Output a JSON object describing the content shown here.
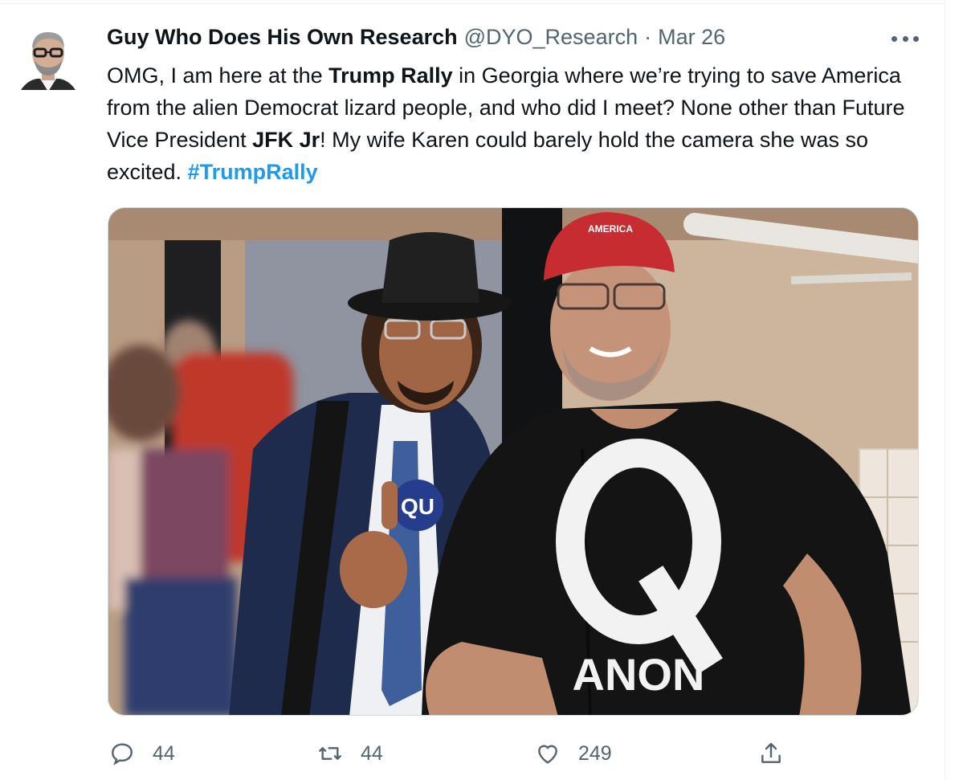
{
  "tweet": {
    "author": {
      "name": "Guy Who Does His Own Research",
      "handle": "@DYO_Research"
    },
    "separator": "·",
    "date": "Mar 26",
    "text": {
      "p1": "OMG, I am here at the ",
      "b1": "Trump Rally",
      "p2": " in Georgia where we’re trying to save America from the alien Democrat lizard people, and who did I meet? None other than Future Vice President ",
      "b2": "JFK Jr",
      "p3": "! My wife Karen could barely hold the camera she was so excited. ",
      "hashtag": "#TrumpRally"
    },
    "media": {
      "cap_text": "AMERICA",
      "button_text": "QU",
      "shirt_letter": "Q",
      "shirt_text": "ANON"
    },
    "actions": {
      "reply_count": "44",
      "retweet_count": "44",
      "like_count": "249"
    }
  },
  "icons": [
    "reply-icon",
    "retweet-icon",
    "like-icon",
    "share-icon",
    "more-options-icon"
  ],
  "colors": {
    "text": "#0f1419",
    "secondary": "#536471",
    "link": "#1d9bf0",
    "border": "#cfd9de"
  }
}
